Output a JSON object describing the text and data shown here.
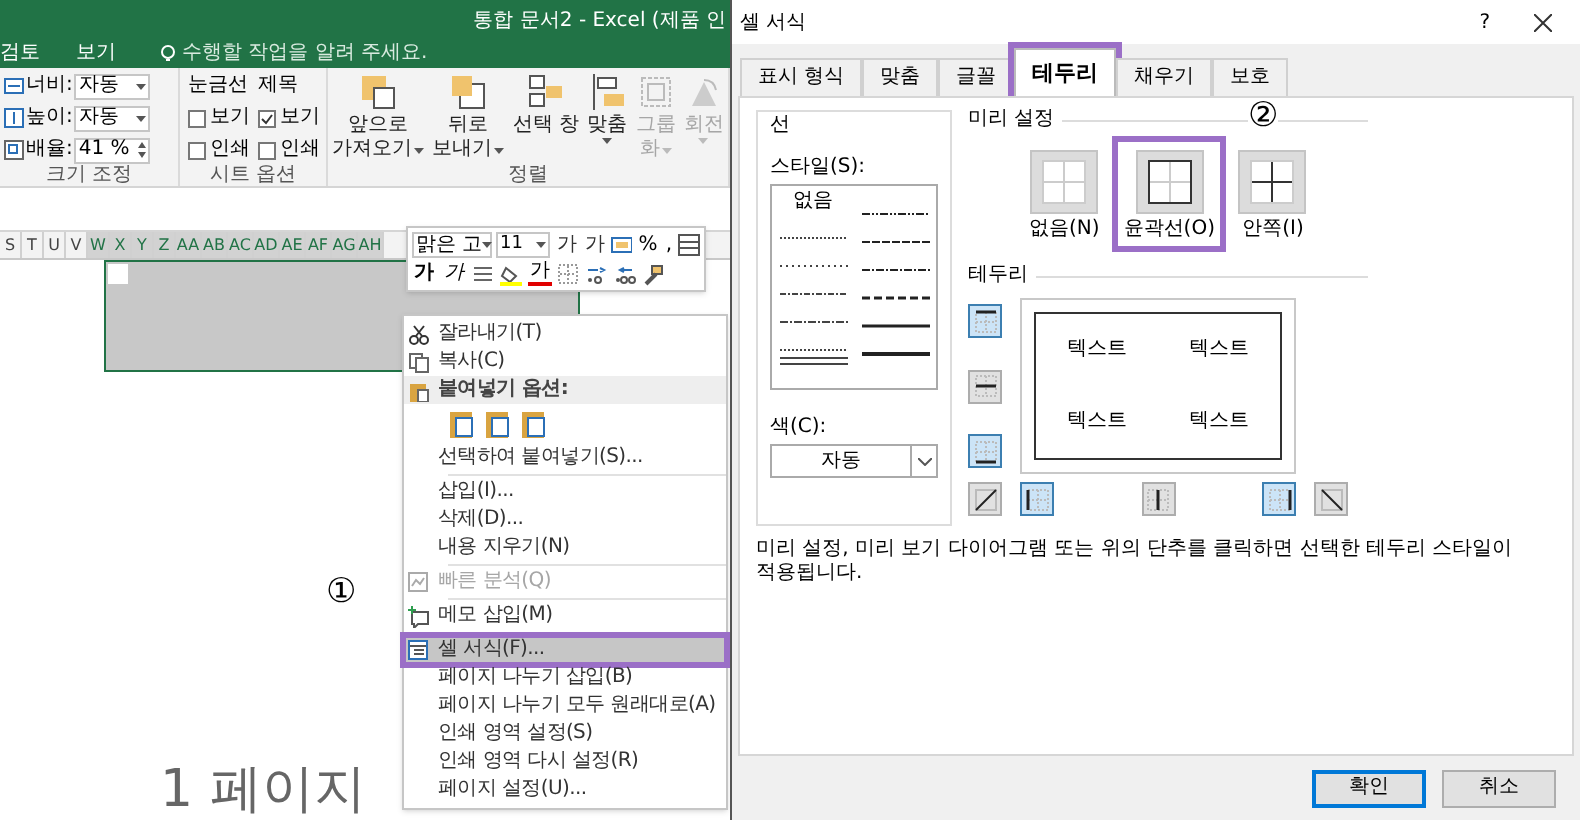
{
  "excel": {
    "title": "통합 문서2 - Excel (제품 인",
    "ribbon_tabs": [
      {
        "label": "검토"
      },
      {
        "label": "보기"
      }
    ],
    "tell_me": "수행할 작업을 알려 주세요.",
    "scale_group": {
      "label": "크기 조정",
      "fields": [
        {
          "kind": "width",
          "label": "너비:",
          "value": "자동"
        },
        {
          "kind": "height",
          "label": "높이:",
          "value": "자동"
        },
        {
          "kind": "scale",
          "label": "배율:",
          "value": "41 %"
        }
      ]
    },
    "sheet_options": {
      "label": "시트 옵션",
      "columns": [
        {
          "heading": "눈금선",
          "options": [
            {
              "label": "보기",
              "checked": false
            },
            {
              "label": "인쇄",
              "checked": false
            }
          ]
        },
        {
          "heading": "제목",
          "options": [
            {
              "label": "보기",
              "checked": true
            },
            {
              "label": "인쇄",
              "checked": false
            }
          ]
        }
      ]
    },
    "arrange": {
      "label": "정렬",
      "buttons": [
        {
          "kind": "forward",
          "lines": [
            "앞으로",
            "가져오기"
          ],
          "dropdown": true,
          "disabled": false
        },
        {
          "kind": "backward",
          "lines": [
            "뒤로",
            "보내기"
          ],
          "dropdown": true,
          "disabled": false
        },
        {
          "kind": "selection_pane",
          "lines": [
            "선택 창"
          ],
          "dropdown": false,
          "disabled": false
        },
        {
          "kind": "align",
          "lines": [
            "맞춤"
          ],
          "dropdown": true,
          "disabled": false
        },
        {
          "kind": "group",
          "lines": [
            "그룹",
            "화"
          ],
          "dropdown": true,
          "disabled": true
        },
        {
          "kind": "rotate",
          "lines": [
            "회전"
          ],
          "dropdown": true,
          "disabled": true
        }
      ]
    },
    "columns": [
      {
        "label": "S",
        "selected": false
      },
      {
        "label": "T",
        "selected": false
      },
      {
        "label": "U",
        "selected": false
      },
      {
        "label": "V",
        "selected": false
      },
      {
        "label": "W",
        "selected": true
      },
      {
        "label": "X",
        "selected": true
      },
      {
        "label": "Y",
        "selected": true
      },
      {
        "label": "Z",
        "selected": true
      },
      {
        "label": "AA",
        "selected": true
      },
      {
        "label": "AB",
        "selected": true
      },
      {
        "label": "AC",
        "selected": true
      },
      {
        "label": "AD",
        "selected": true
      },
      {
        "label": "AE",
        "selected": true
      },
      {
        "label": "AF",
        "selected": true
      },
      {
        "label": "AG",
        "selected": true
      },
      {
        "label": "AH",
        "selected": true
      }
    ],
    "mini_toolbar": {
      "font": "맑은 고",
      "size": "11",
      "row_1": [
        {
          "kind": "grow_font",
          "text": "가"
        },
        {
          "kind": "shrink_font",
          "text": "가"
        },
        {
          "kind": "accounting"
        },
        {
          "kind": "percent",
          "text": "%"
        },
        {
          "kind": "comma",
          "text": ","
        },
        {
          "kind": "table_format"
        }
      ],
      "row_2": [
        {
          "kind": "bold",
          "text": "가"
        },
        {
          "kind": "italic",
          "text": "가"
        },
        {
          "kind": "align"
        },
        {
          "kind": "fill_color"
        },
        {
          "kind": "font_color",
          "text": "가"
        },
        {
          "kind": "borders"
        },
        {
          "kind": "inc_decimal"
        },
        {
          "kind": "dec_decimal"
        },
        {
          "kind": "format_painter"
        }
      ]
    },
    "context_menu": [
      {
        "kind": "cut",
        "label": "잘라내기(T)",
        "disabled": false,
        "highlighted": false
      },
      {
        "kind": "copy",
        "label": "복사(C)",
        "disabled": false,
        "highlighted": false
      },
      {
        "kind": "header",
        "label": "붙여넣기 옵션:"
      },
      {
        "kind": "paste_icons"
      },
      {
        "kind": "command",
        "label": "선택하여 붙여넣기(S)...",
        "disabled": false,
        "highlighted": false
      },
      {
        "kind": "separator"
      },
      {
        "kind": "command",
        "label": "삽입(I)...",
        "disabled": false,
        "highlighted": false
      },
      {
        "kind": "command",
        "label": "삭제(D)...",
        "disabled": false,
        "highlighted": false
      },
      {
        "kind": "command",
        "label": "내용 지우기(N)",
        "disabled": false,
        "highlighted": false
      },
      {
        "kind": "separator"
      },
      {
        "kind": "quick_analysis",
        "label": "빠른 분석(Q)",
        "disabled": true,
        "highlighted": false
      },
      {
        "kind": "separator"
      },
      {
        "kind": "comment",
        "label": "메모 삽입(M)",
        "disabled": false,
        "highlighted": false
      },
      {
        "kind": "separator"
      },
      {
        "kind": "format_cells",
        "label": "셀 서식(F)...",
        "disabled": false,
        "highlighted": true
      },
      {
        "kind": "command",
        "label": "페이지 나누기 삽입(B)",
        "disabled": false,
        "highlighted": false
      },
      {
        "kind": "command",
        "label": "페이지 나누기 모두 원래대로(A)",
        "disabled": false,
        "highlighted": false
      },
      {
        "kind": "command",
        "label": "인쇄 영역 설정(S)",
        "disabled": false,
        "highlighted": false
      },
      {
        "kind": "command",
        "label": "인쇄 영역 다시 설정(R)",
        "disabled": false,
        "highlighted": false
      },
      {
        "kind": "command",
        "label": "페이지 설정(U)...",
        "disabled": false,
        "highlighted": false
      }
    ],
    "step_marker": "①",
    "background_heading": "1 페이지"
  },
  "dialog": {
    "title": "셀 서식",
    "help": "?",
    "tabs": [
      {
        "label": "표시 형식",
        "selected": false,
        "highlighted": false
      },
      {
        "label": "맞춤",
        "selected": false,
        "highlighted": false
      },
      {
        "label": "글꼴",
        "selected": false,
        "highlighted": false
      },
      {
        "label": "테두리",
        "selected": true,
        "highlighted": true
      },
      {
        "label": "채우기",
        "selected": false,
        "highlighted": false
      },
      {
        "label": "보호",
        "selected": false,
        "highlighted": false
      }
    ],
    "line": {
      "title": "선",
      "style_label": "스타일(S):",
      "none_style": "없음",
      "color_label": "색(C):",
      "color_value": "자동"
    },
    "presets": {
      "title": "미리 설정",
      "step_marker": "②",
      "items": [
        {
          "kind": "none",
          "label": "없음(N)",
          "highlighted": false
        },
        {
          "kind": "outline",
          "label": "윤곽선(O)",
          "highlighted": true
        },
        {
          "kind": "inside",
          "label": "안쪽(I)",
          "highlighted": false
        }
      ]
    },
    "border": {
      "title": "테두리",
      "preview_text": [
        "텍스트",
        "텍스트",
        "텍스트",
        "텍스트"
      ],
      "buttons": [
        {
          "kind": "top",
          "pressed": true
        },
        {
          "kind": "middle_h",
          "pressed": false
        },
        {
          "kind": "bottom",
          "pressed": true
        },
        {
          "kind": "diag_up",
          "pressed": false
        },
        {
          "kind": "left",
          "pressed": true
        },
        {
          "kind": "middle_v",
          "pressed": false
        },
        {
          "kind": "right",
          "pressed": true
        },
        {
          "kind": "diag_down",
          "pressed": false
        }
      ]
    },
    "description": "미리 설정, 미리 보기 다이어그램 또는 위의 단추를 클릭하면 선택한 테두리 스타일이 적용됩니다.",
    "buttons": [
      {
        "label": "확인",
        "default": true
      },
      {
        "label": "취소",
        "default": false
      }
    ]
  }
}
